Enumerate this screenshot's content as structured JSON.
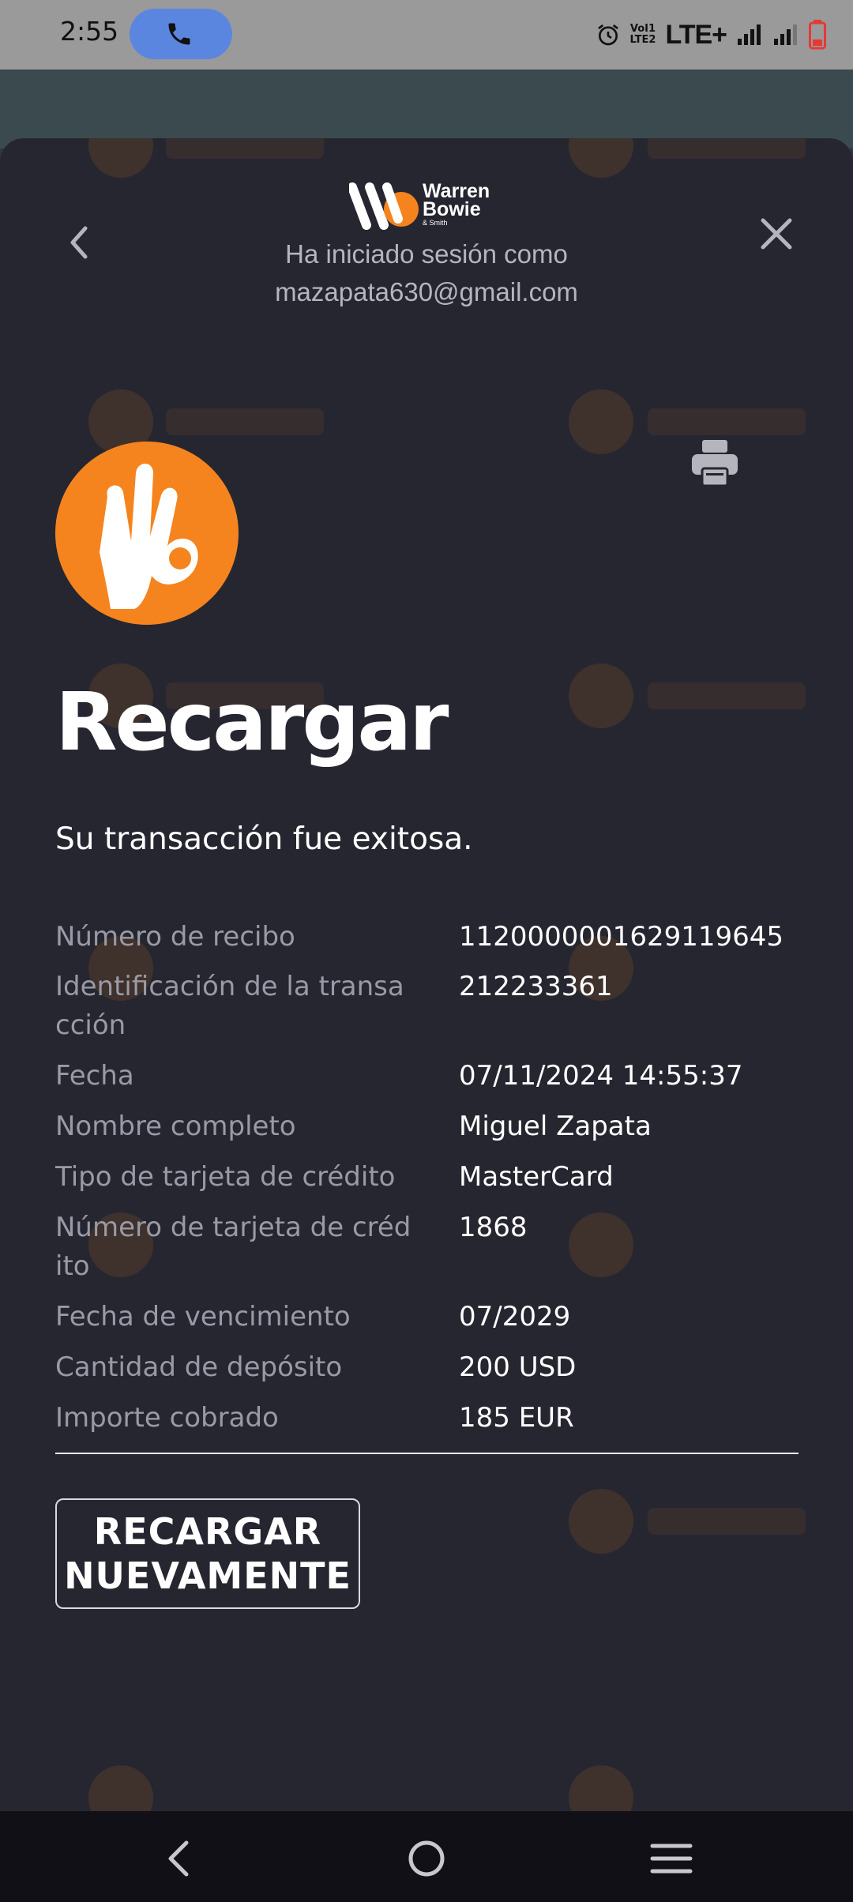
{
  "status_bar": {
    "time": "2:55",
    "network": "LTE+",
    "volte_lines": [
      "VoI1",
      "LTE2"
    ],
    "icons": [
      "phone-call-icon",
      "alarm-icon",
      "volte-icon",
      "signal-icon",
      "signal-icon",
      "battery-low-icon"
    ]
  },
  "header": {
    "brand_lines": [
      "Warren",
      "Bowie"
    ],
    "brand_sub": "& Smith",
    "session_label": "Ha iniciado sesión como",
    "email": "mazapata630@gmail.com",
    "icons": [
      "back-chevron-icon",
      "close-icon",
      "printer-icon",
      "ok-hand-icon"
    ]
  },
  "main": {
    "title": "Recargar",
    "success_message": "Su transacción fue exitosa.",
    "details": [
      {
        "label": "Número de recibo",
        "value": "1120000001629119645"
      },
      {
        "label": "Identificación de la transa\ncción",
        "value": "212233361"
      },
      {
        "label": "Fecha",
        "value": "07/11/2024 14:55:37"
      },
      {
        "label": "Nombre completo",
        "value": "Miguel Zapata"
      },
      {
        "label": "Tipo de tarjeta de crédito",
        "value": "MasterCard"
      },
      {
        "label": "Número de tarjeta de créd\nito",
        "value": "1868"
      },
      {
        "label": "Fecha de vencimiento",
        "value": "07/2029"
      },
      {
        "label": "Cantidad de depósito",
        "value": "200 USD"
      },
      {
        "label": "Importe cobrado",
        "value": "185 EUR"
      }
    ],
    "again_button": "RECARGAR\nNUEVAMENTE"
  },
  "colors": {
    "sheet_bg": "#262631",
    "accent_orange": "#f5841f",
    "label_gray": "#9a9aa6",
    "value_white": "#ffffff"
  },
  "nav": {
    "icons": [
      "nav-back-icon",
      "nav-home-icon",
      "nav-menu-icon"
    ]
  }
}
